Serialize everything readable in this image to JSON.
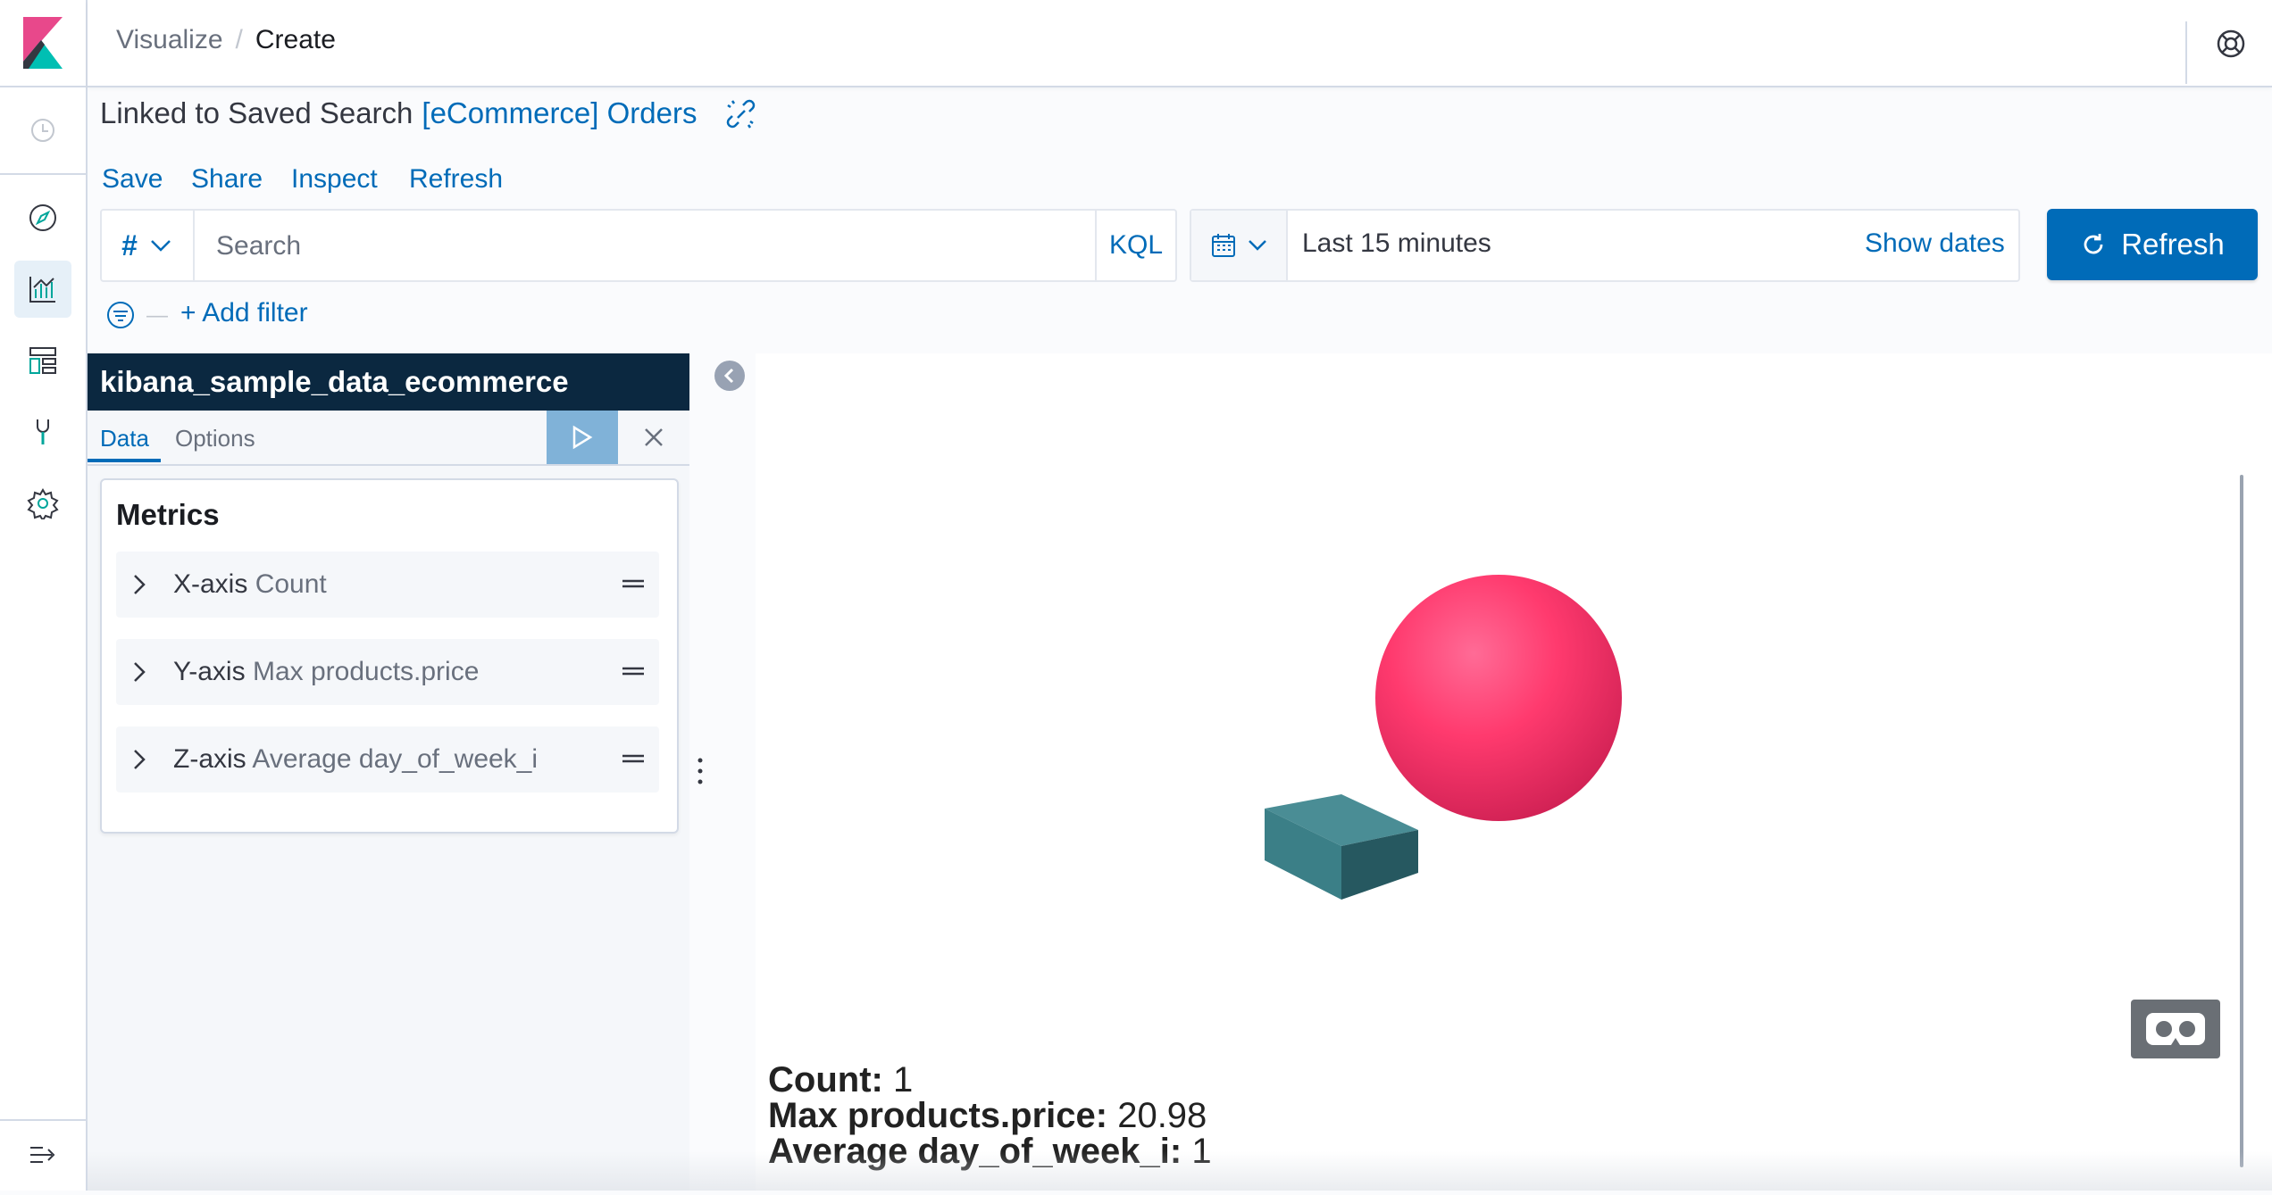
{
  "breadcrumbs": [
    "Visualize",
    "Create"
  ],
  "breadcrumb_separator": "/",
  "linked": {
    "label": "Linked to Saved Search",
    "name": "[eCommerce] Orders"
  },
  "top_menu": [
    "Save",
    "Share",
    "Inspect",
    "Refresh"
  ],
  "query": {
    "language_symbol": "#",
    "placeholder": "Search",
    "language": "KQL"
  },
  "time": {
    "range": "Last 15 minutes",
    "show_dates": "Show dates"
  },
  "refresh_button": "Refresh",
  "filter": {
    "add_label": "+ Add filter",
    "separator": "—"
  },
  "editor": {
    "index_pattern": "kibana_sample_data_ecommerce",
    "tabs": [
      "Data",
      "Options"
    ],
    "metrics_title": "Metrics",
    "metrics": [
      {
        "axis": "X-axis",
        "field": "Count"
      },
      {
        "axis": "Y-axis",
        "field": "Max products.price"
      },
      {
        "axis": "Z-axis",
        "field": "Average day_of_week_i"
      }
    ]
  },
  "tooltip": [
    {
      "label": "Count:",
      "value": "1"
    },
    {
      "label": "Max products.price:",
      "value": "20.98"
    },
    {
      "label": "Average day_of_week_i:",
      "value": "1"
    }
  ],
  "colors": {
    "accent": "#006bb8",
    "header_dark": "#0b2840",
    "sphere": "#ff3a6e",
    "box": "#3b7f87"
  },
  "icons": [
    "kibana-logo",
    "clock-icon",
    "discover-icon",
    "visualize-icon",
    "dashboard-icon",
    "devtools-icon",
    "gear-icon",
    "collapse-nav-icon",
    "help-icon",
    "unlink-icon",
    "calendar-icon",
    "refresh-icon",
    "filter-icon",
    "play-icon",
    "close-icon",
    "chevron-right-icon",
    "drag-handle-icon",
    "vr-headset-icon"
  ]
}
